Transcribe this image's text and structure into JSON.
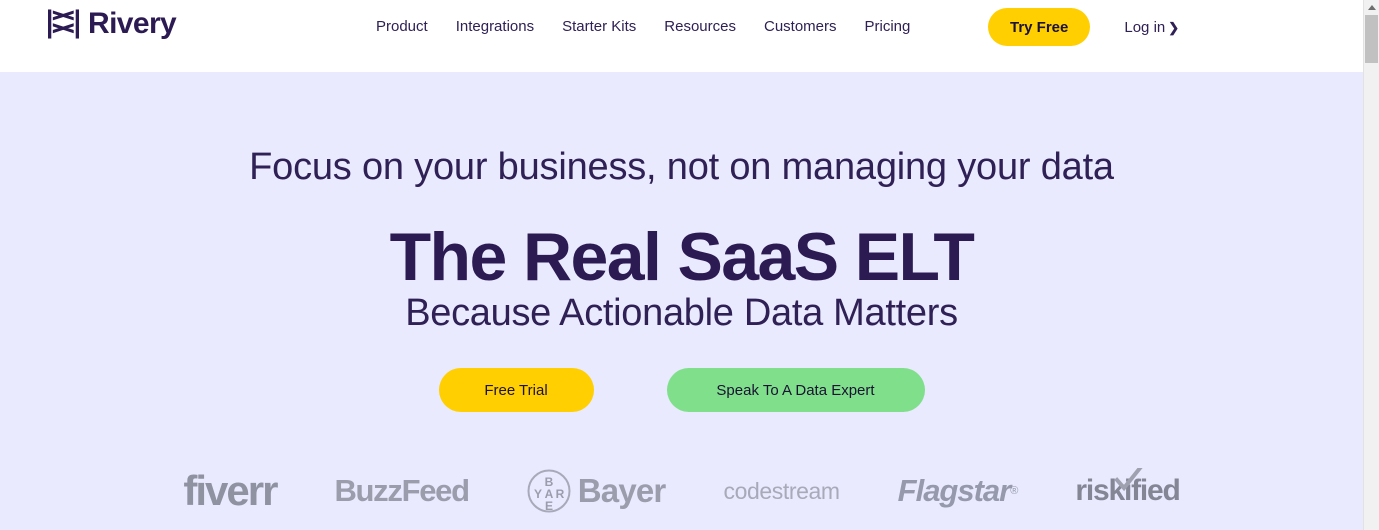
{
  "header": {
    "brand": {
      "name": "Rivery",
      "logo_icon": "rivery-arrows-icon",
      "color": "#2c1a53"
    },
    "nav_items": [
      {
        "label": "Product"
      },
      {
        "label": "Integrations"
      },
      {
        "label": "Starter Kits"
      },
      {
        "label": "Resources"
      },
      {
        "label": "Customers"
      },
      {
        "label": "Pricing"
      }
    ],
    "try_free_label": "Try Free",
    "login_label": "Log in",
    "login_chevron": "❯"
  },
  "hero": {
    "eyebrow": "Focus on your business, not on managing your data",
    "title": "The Real SaaS ELT",
    "subtitle": "Because Actionable Data Matters",
    "cta_primary": "Free Trial",
    "cta_secondary": "Speak To A Data Expert",
    "background_color": "#e9eafd"
  },
  "client_logos": [
    {
      "name": "fiverr"
    },
    {
      "name": "BuzzFeed"
    },
    {
      "name": "Bayer"
    },
    {
      "name": "codestream"
    },
    {
      "name": "Flagstar",
      "trademark": "®"
    },
    {
      "name": "riskified"
    }
  ],
  "colors": {
    "brand_navy": "#2c1a53",
    "accent_yellow": "#ffcf01",
    "accent_green": "#7fdf8b",
    "hero_bg": "#e9eafd",
    "logo_gray": "#8d8f9e"
  },
  "scrollbar": {
    "up_arrow": "scroll-up-arrow-icon"
  }
}
